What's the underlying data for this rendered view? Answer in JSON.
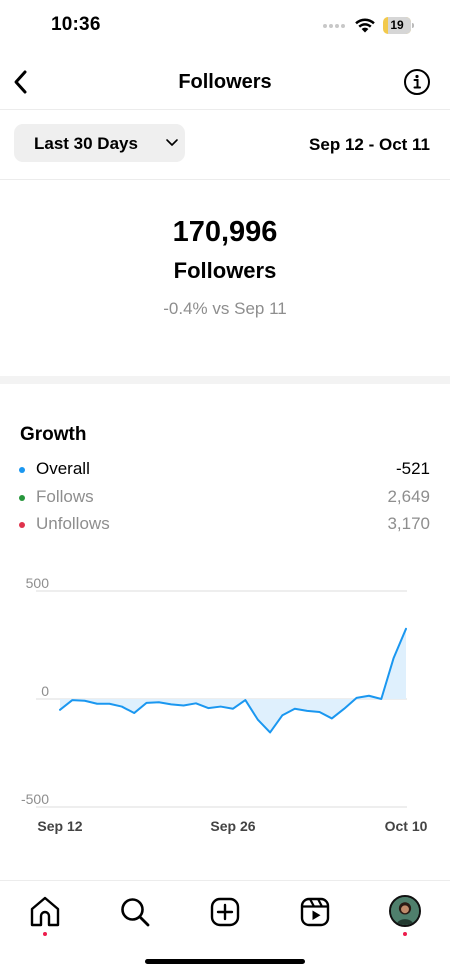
{
  "status_bar": {
    "time": "10:36",
    "battery": "19",
    "battery_level": 0.19
  },
  "header": {
    "title": "Followers",
    "back_icon": "chevron-left-icon",
    "info_icon": "info-icon"
  },
  "filter": {
    "period_label": "Last 30 Days",
    "date_range": "Sep 12 - Oct 11"
  },
  "summary": {
    "count": "170,996",
    "label": "Followers",
    "change": "-0.4% vs Sep 11"
  },
  "growth": {
    "title": "Growth",
    "legend": [
      {
        "label": "Overall",
        "value": "-521",
        "color": "#1a97f0"
      },
      {
        "label": "Follows",
        "value": "2,649",
        "color": "#27963c"
      },
      {
        "label": "Unfollows",
        "value": "3,170",
        "color": "#e0334c"
      }
    ]
  },
  "chart_data": {
    "type": "area",
    "series": [
      {
        "name": "Overall",
        "values": [
          -50,
          -5,
          -8,
          -22,
          -22,
          -35,
          -65,
          -18,
          -15,
          -25,
          -30,
          -20,
          -42,
          -35,
          -45,
          -5,
          -95,
          -155,
          -75,
          -45,
          -55,
          -60,
          -90,
          -45,
          5,
          15,
          0,
          190,
          325
        ]
      }
    ],
    "x_tick_labels": [
      "Sep 12",
      "Sep 26",
      "Oct 10"
    ],
    "y_tick_labels": [
      "500",
      "0",
      "-500"
    ],
    "ylim": [
      -500,
      500
    ],
    "grid": true,
    "colors": {
      "line": "#1a97f0",
      "fill": "#dff0fd"
    }
  },
  "tab_bar": {
    "icons": [
      "home-icon",
      "search-icon",
      "create-icon",
      "reels-icon",
      "profile-avatar"
    ],
    "dot_color": "#ed1c4c"
  }
}
